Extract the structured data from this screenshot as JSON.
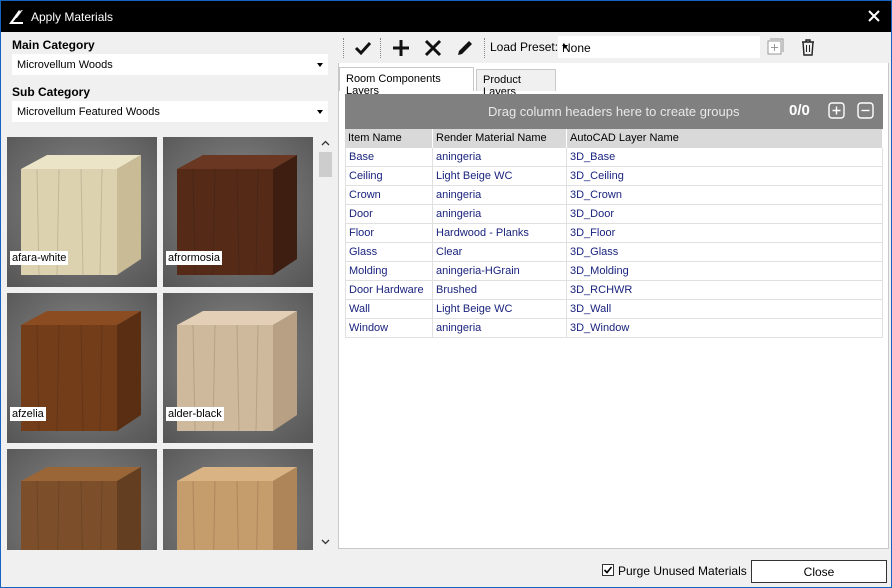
{
  "window": {
    "title": "Apply Materials"
  },
  "main_category": {
    "label": "Main Category",
    "value": "Microvellum Woods"
  },
  "sub_category": {
    "label": "Sub Category",
    "value": "Microvellum Featured Woods"
  },
  "swatches": [
    {
      "name": "afara-white",
      "color_light": "#ece4c6",
      "color_mid": "#ddd2b0",
      "color_dark": "#c8bb96"
    },
    {
      "name": "afrormosia",
      "color_light": "#6a3822",
      "color_mid": "#552b18",
      "color_dark": "#3e1e10"
    },
    {
      "name": "afzelia",
      "color_light": "#8c4c22",
      "color_mid": "#733d1a",
      "color_dark": "#5a2e12"
    },
    {
      "name": "alder-black",
      "color_light": "#e2cfb6",
      "color_mid": "#cfb99c",
      "color_dark": "#b8a084"
    },
    {
      "name": "",
      "color_light": "#9a6638",
      "color_mid": "#7c4f2a",
      "color_dark": "#633e20"
    },
    {
      "name": "",
      "color_light": "#d9b384",
      "color_mid": "#c59c6c",
      "color_dark": "#ad8558"
    }
  ],
  "toolbar": {
    "check_icon": "check-icon",
    "add_icon": "plus-icon",
    "delete_icon": "x-icon",
    "edit_icon": "pencil-icon",
    "preset_label": "Load Preset:",
    "preset_value": "None"
  },
  "tabs": [
    {
      "label": "Room Components Layers",
      "active": true
    },
    {
      "label": "Product Layers",
      "active": false
    }
  ],
  "grid": {
    "group_hint": "Drag column headers here to create groups",
    "count": "0/0",
    "columns": [
      "Item Name",
      "Render Material Name",
      "AutoCAD Layer Name"
    ],
    "rows": [
      [
        "Base",
        "aningeria",
        "3D_Base"
      ],
      [
        "Ceiling",
        "Light Beige WC",
        "3D_Ceiling"
      ],
      [
        "Crown",
        "aningeria",
        "3D_Crown"
      ],
      [
        "Door",
        "aningeria",
        "3D_Door"
      ],
      [
        "Floor",
        "Hardwood - Planks",
        "3D_Floor"
      ],
      [
        "Glass",
        "Clear",
        "3D_Glass"
      ],
      [
        "Molding",
        "aningeria-HGrain",
        "3D_Molding"
      ],
      [
        "Door Hardware",
        "Brushed",
        "3D_RCHWR"
      ],
      [
        "Wall",
        "Light Beige WC",
        "3D_Wall"
      ],
      [
        "Window",
        "aningeria",
        "3D_Window"
      ]
    ]
  },
  "footer": {
    "purge_label": "Purge Unused Materials",
    "purge_checked": true,
    "close_label": "Close"
  },
  "colors": {
    "link_text": "#1a237e",
    "titlebar": "#000000",
    "group_header": "#808080"
  }
}
